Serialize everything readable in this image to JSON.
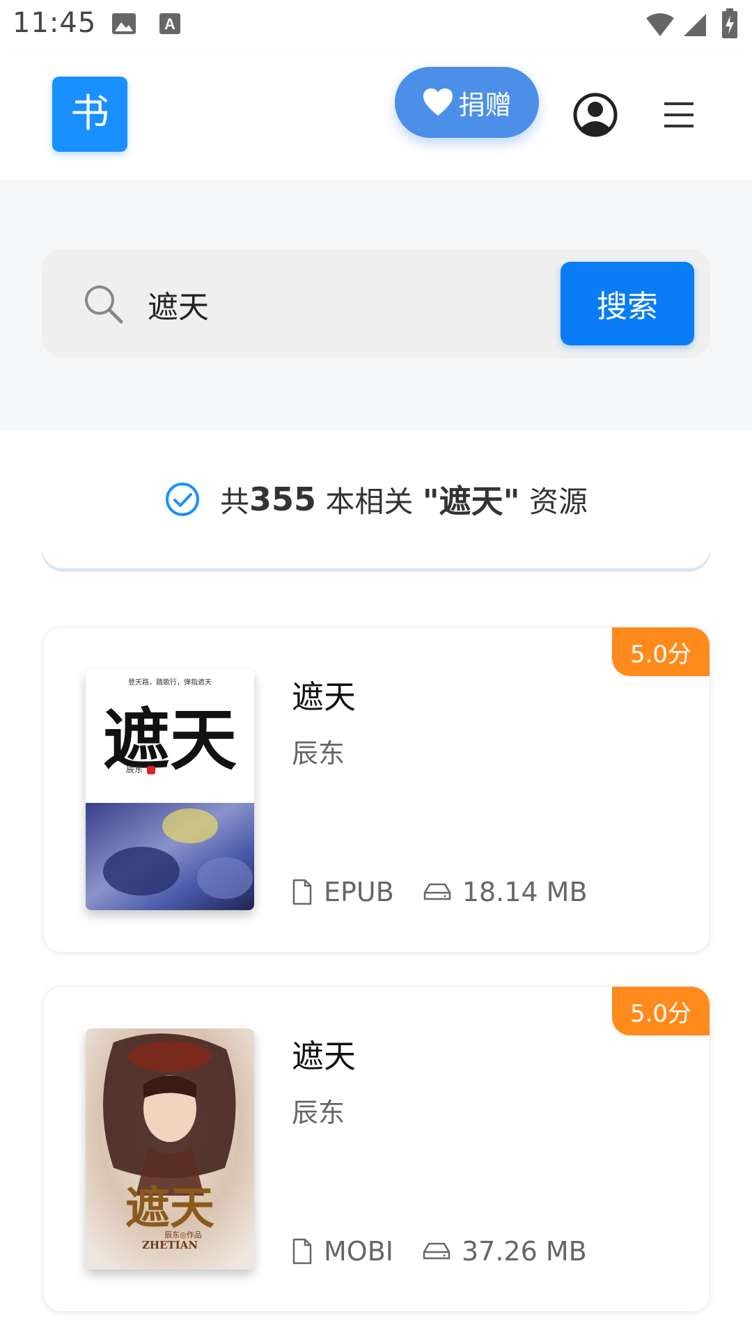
{
  "status_bar": {
    "time": "11:45"
  },
  "header": {
    "logo_text": "书",
    "donate_label": "捐赠",
    "accent_color": "#1890ff"
  },
  "search": {
    "query": "遮天",
    "button_label": "搜索"
  },
  "summary": {
    "prefix": "共",
    "count": "355",
    "middle": " 本相关 ",
    "query_quoted": "\"遮天\"",
    "suffix": " 资源"
  },
  "books": [
    {
      "title": "遮天",
      "author": "辰东",
      "rating": "5.0分",
      "format": "EPUB",
      "size": "18.14 MB",
      "cover_text": "遮天",
      "cover_tagline": "登天路，踏歌行，弹指遮天",
      "cover_author": "辰东"
    },
    {
      "title": "遮天",
      "author": "辰东",
      "rating": "5.0分",
      "format": "MOBI",
      "size": "37.26 MB",
      "cover_text": "遮天",
      "cover_subtitle": "辰东◎作品",
      "cover_pinyin": "ZHETIAN"
    }
  ],
  "colors": {
    "primary_button": "#0a7cf5",
    "rating_badge": "#ff8a1c"
  }
}
